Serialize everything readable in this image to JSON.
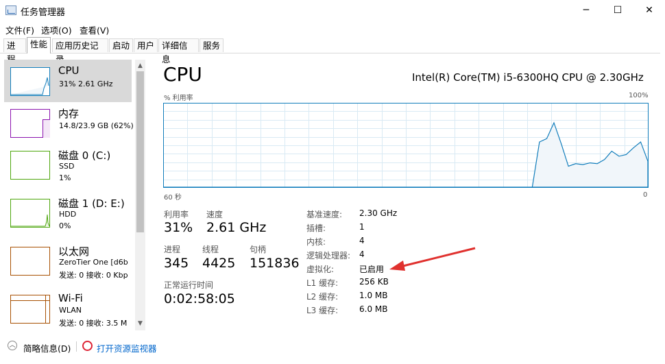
{
  "window": {
    "title": "任务管理器",
    "controls": {
      "minimize": "─",
      "maximize": "☐",
      "close": "✕"
    }
  },
  "menu": {
    "items": [
      {
        "label": "文件(F)"
      },
      {
        "label": "选项(O)"
      },
      {
        "label": "查看(V)"
      }
    ]
  },
  "tabs": [
    {
      "label": "进程"
    },
    {
      "label": "性能"
    },
    {
      "label": "应用历史记录"
    },
    {
      "label": "启动"
    },
    {
      "label": "用户"
    },
    {
      "label": "详细信息"
    },
    {
      "label": "服务"
    }
  ],
  "active_tab": "性能",
  "resources": [
    {
      "name": "CPU",
      "lines": [
        "31% 2.61 GHz"
      ],
      "color": "#117dbb"
    },
    {
      "name": "内存",
      "lines": [
        "14.8/23.9 GB (62%)"
      ],
      "color": "#8b12ae"
    },
    {
      "name": "磁盘 0 (C:)",
      "lines": [
        "SSD",
        "1%"
      ],
      "color": "#4da60c"
    },
    {
      "name": "磁盘 1 (D: E:)",
      "lines": [
        "HDD",
        "0%"
      ],
      "color": "#4da60c"
    },
    {
      "name": "以太网",
      "lines": [
        "ZeroTier One [d6b",
        "发送: 0 接收: 0 Kbp"
      ],
      "color": "#a74f01"
    },
    {
      "name": "Wi-Fi",
      "lines": [
        "WLAN",
        "发送: 0 接收: 3.5 M"
      ],
      "color": "#a74f01"
    }
  ],
  "main": {
    "title": "CPU",
    "model": "Intel(R) Core(TM) i5-6300HQ CPU @ 2.30GHz",
    "graph_label": "% 利用率",
    "graph_max": "100%",
    "graph_time_left": "60 秒",
    "graph_time_right": "0",
    "stats": {
      "utilization_label": "利用率",
      "utilization": "31%",
      "speed_label": "速度",
      "speed": "2.61 GHz",
      "processes_label": "进程",
      "processes": "345",
      "threads_label": "线程",
      "threads": "4425",
      "handles_label": "句柄",
      "handles": "151836",
      "uptime_label": "正常运行时间",
      "uptime": "0:02:58:05"
    },
    "specs": [
      {
        "label": "基准速度:",
        "value": "2.30 GHz"
      },
      {
        "label": "插槽:",
        "value": "1"
      },
      {
        "label": "内核:",
        "value": "4"
      },
      {
        "label": "逻辑处理器:",
        "value": "4"
      },
      {
        "label": "虚拟化:",
        "value": "已启用"
      },
      {
        "label": "L1 缓存:",
        "value": "256 KB"
      },
      {
        "label": "L2 缓存:",
        "value": "1.0 MB"
      },
      {
        "label": "L3 缓存:",
        "value": "6.0 MB"
      }
    ]
  },
  "chart_data": {
    "type": "area",
    "series": [
      {
        "values": [
          0,
          0,
          0,
          0,
          0,
          0,
          0,
          0,
          0,
          0,
          0,
          0,
          0,
          0,
          0,
          0,
          0,
          0,
          0,
          0,
          0,
          0,
          0,
          0,
          0,
          0,
          0,
          0,
          0,
          0,
          0,
          0,
          0,
          0,
          0,
          0,
          0,
          0,
          0,
          0,
          0,
          0,
          0,
          0,
          0,
          0,
          0,
          0,
          0,
          0,
          0,
          0,
          54,
          58,
          77,
          52,
          25,
          28,
          27,
          29,
          28,
          33,
          43,
          37,
          39,
          47,
          54,
          31
        ]
      }
    ],
    "ylim": [
      0,
      100
    ],
    "color": "#117dbb",
    "fill": "#f1f6fa"
  },
  "footer": {
    "collapse_label": "简略信息(D)",
    "monitor_link": "打开资源监视器"
  },
  "annotation": {
    "arrow_color": "#e0312e"
  }
}
